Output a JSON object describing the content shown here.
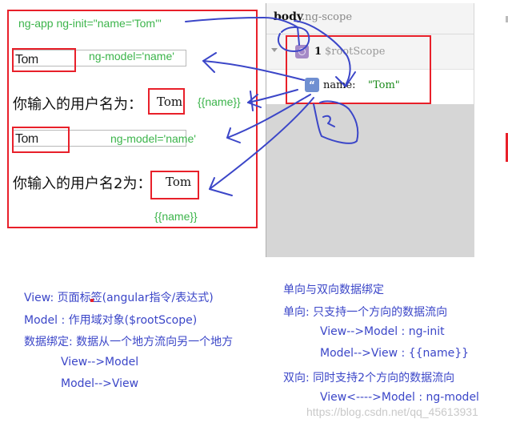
{
  "app": {
    "ng_app_label": "ng-app ng-init=\"name='Tom'\"",
    "input1": {
      "value": "Tom",
      "annotation": "ng-model='name'"
    },
    "output1": {
      "label": "你输入的用户名为：",
      "value": "Tom",
      "annotation": "{{name}}"
    },
    "input2": {
      "value": "Tom",
      "annotation": "ng-model='name'"
    },
    "output2": {
      "label": "你输入的用户名2为：",
      "value": "Tom",
      "annotation": "{{name}}"
    }
  },
  "devtools": {
    "breadcrumb_tag": "body",
    "breadcrumb_class": ".ng-scope",
    "scope_index": "1",
    "scope_name": "$rootScope",
    "property_name": "name:",
    "property_value": "\"Tom\"",
    "handwritten_mark": "2"
  },
  "notes_left": [
    "View: 页面标签(angular指令/表达式)",
    "Model : 作用域对象($rootScope)",
    "数据绑定: 数据从一个地方流向另一个地方",
    "View-->Model",
    "Model-->View"
  ],
  "notes_right": [
    "单向与双向数据绑定",
    "单向: 只支持一个方向的数据流向",
    "View-->Model :  ng-init",
    "Model-->View :  {{name}}",
    "双向: 同时支持2个方向的数据流向",
    "View<---->Model : ng-model"
  ],
  "watermark": "https://blog.csdn.net/qq_45613931",
  "colors": {
    "highlight_red": "#e8202a",
    "annotation_green": "#3cb44b",
    "ink_blue": "#3b46c8",
    "string_green": "#1a8a1a"
  }
}
